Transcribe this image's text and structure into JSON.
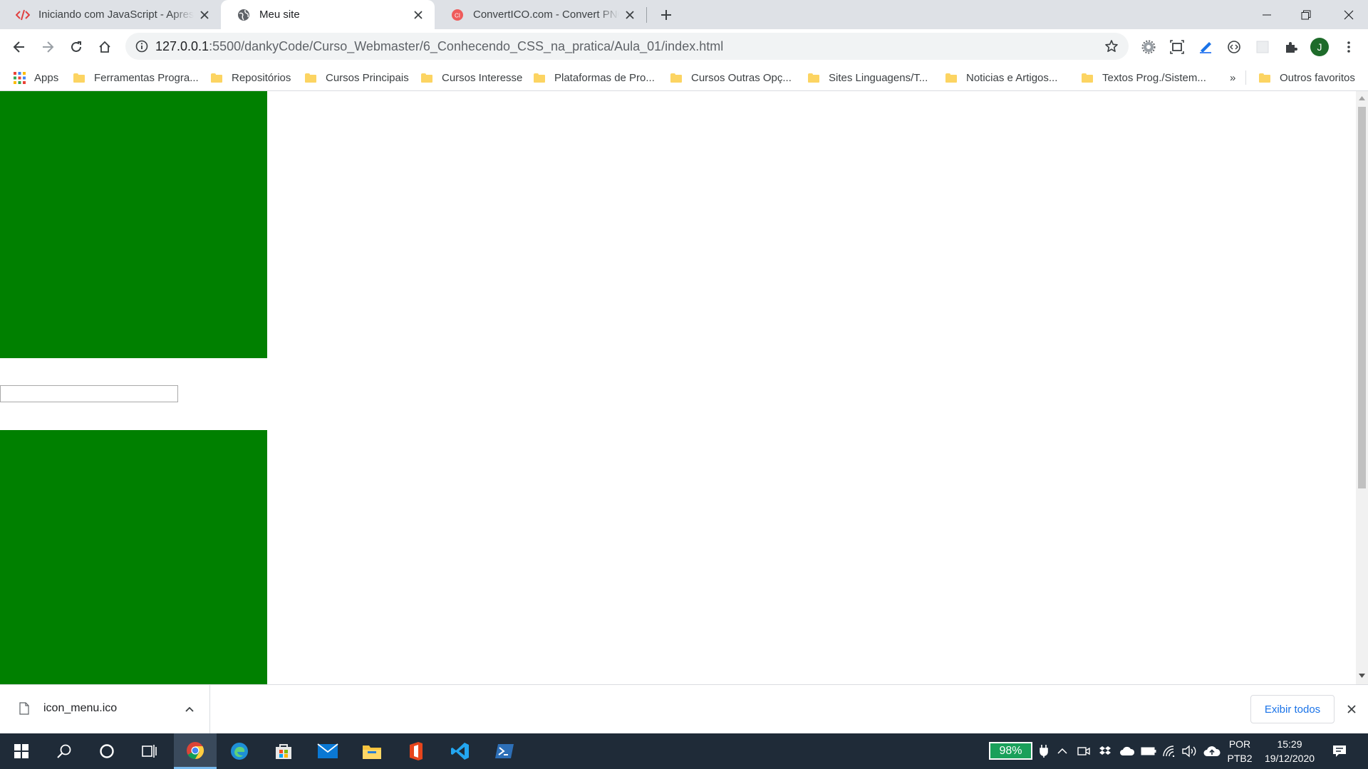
{
  "browser": {
    "tabs": [
      {
        "title": "Iniciando com JavaScript - Apresentação",
        "favicon": "code-icon",
        "active": false
      },
      {
        "title": "Meu site",
        "favicon": "globe-icon",
        "active": true
      },
      {
        "title": "ConvertICO.com - Convert PNG to ICO",
        "favicon": "converter-icon",
        "active": false
      }
    ],
    "url_host": "127.0.0.1",
    "url_path": ":5500/dankyCode/Curso_Webmaster/6_Conhecendo_CSS_na_pratica/Aula_01/index.html",
    "profile_initial": "J",
    "bookmarks": [
      "Apps",
      "Ferramentas Progra...",
      "Repositórios",
      "Cursos Principais",
      "Cursos Interesse",
      "Plataformas de Pro...",
      "Cursos Outras Opç...",
      "Sites Linguagens/T...",
      "Noticias e Artigos...",
      "Textos Prog./Sistem..."
    ],
    "bookmarks_overflow": "»",
    "other_bookmarks": "Outros favoritos"
  },
  "page": {
    "box_color": "#008000",
    "input_value": ""
  },
  "downloads": {
    "file_name": "icon_menu.ico",
    "show_all_label": "Exibir todos"
  },
  "taskbar": {
    "battery_percent": "98%",
    "language": "POR",
    "layout": "PTB2",
    "time": "15:29",
    "date": "19/12/2020"
  },
  "colors": {
    "accent_blue": "#1a73e8",
    "taskbar_bg": "#1f2b38",
    "tabstrip_bg": "#dee1e6"
  }
}
